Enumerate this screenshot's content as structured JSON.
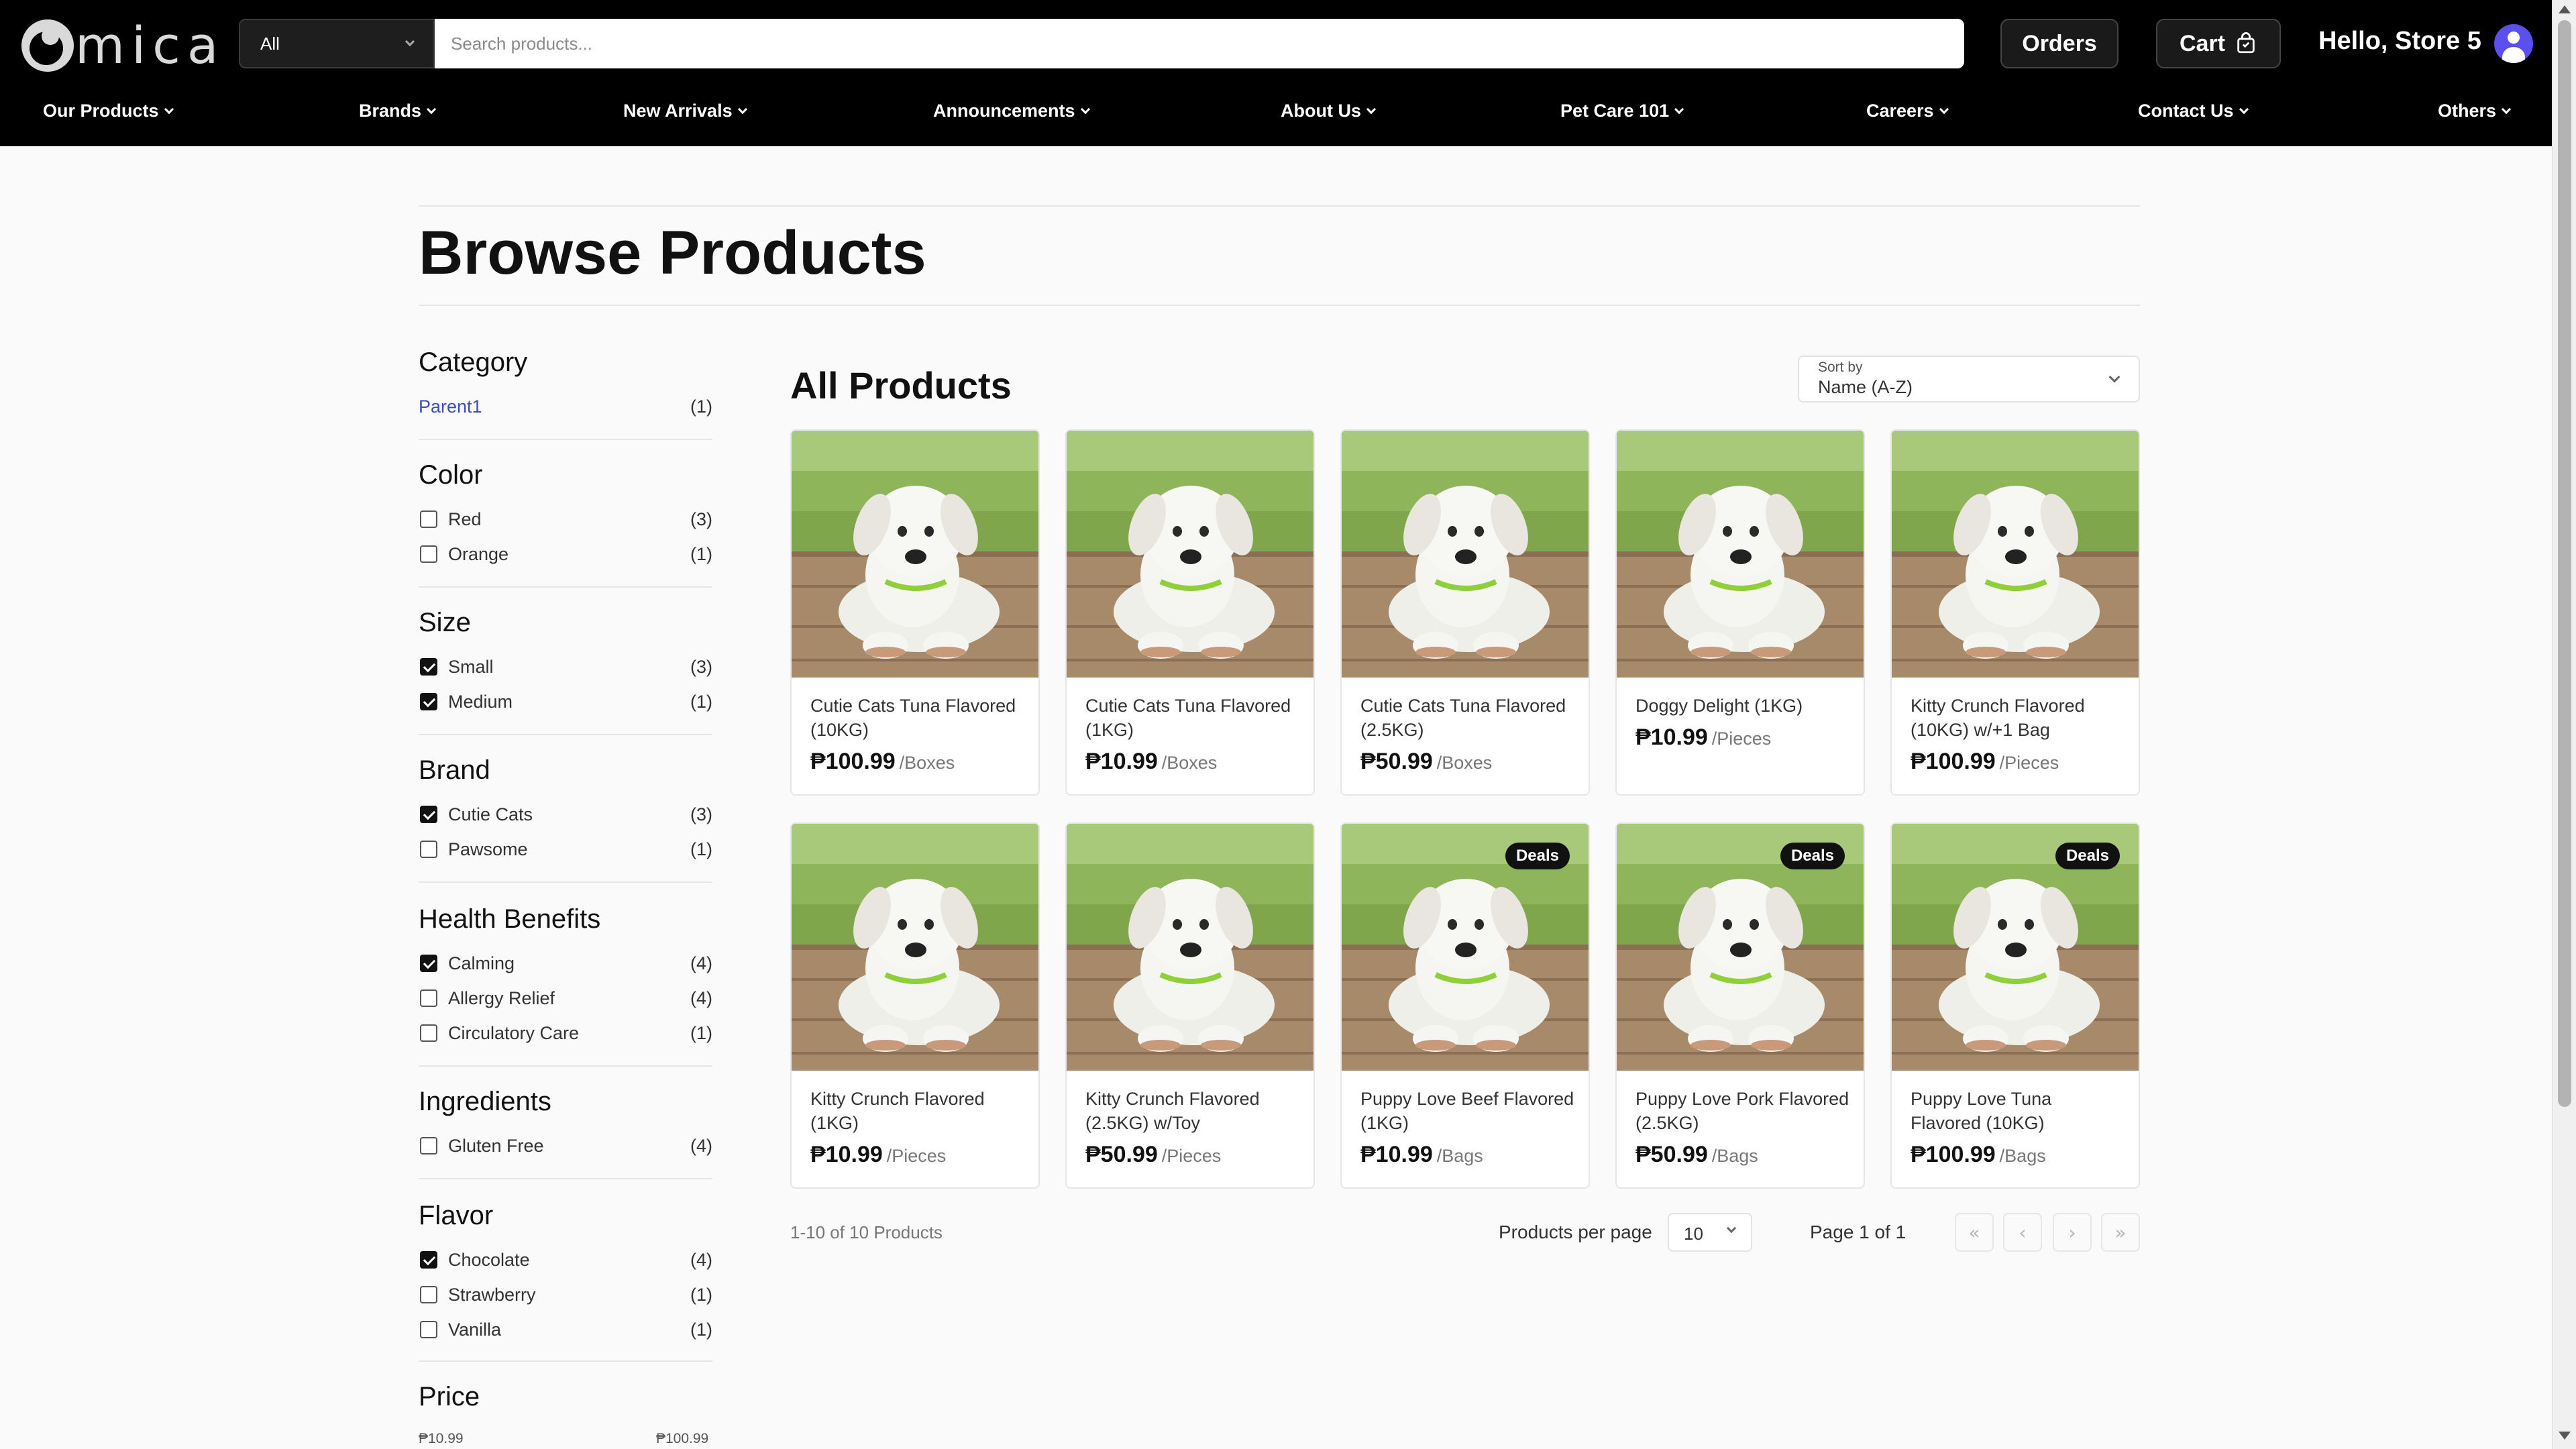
{
  "header": {
    "logo_text": "mica",
    "search_category": "All",
    "search_placeholder": "Search products...",
    "orders_label": "Orders",
    "cart_label": "Cart",
    "greeting": "Hello, Store 5",
    "nav": [
      "Our Products",
      "Brands",
      "New Arrivals",
      "Announcements",
      "About Us",
      "Pet Care 101",
      "Careers",
      "Contact Us",
      "Others"
    ]
  },
  "page_title": "Browse Products",
  "filters": {
    "category": {
      "title": "Category",
      "items": [
        {
          "label": "Parent1",
          "count": "(1)"
        }
      ]
    },
    "color": {
      "title": "Color",
      "items": [
        {
          "label": "Red",
          "count": "(3)",
          "checked": false
        },
        {
          "label": "Orange",
          "count": "(1)",
          "checked": false
        }
      ]
    },
    "size": {
      "title": "Size",
      "items": [
        {
          "label": "Small",
          "count": "(3)",
          "checked": true
        },
        {
          "label": "Medium",
          "count": "(1)",
          "checked": true
        }
      ]
    },
    "brand": {
      "title": "Brand",
      "items": [
        {
          "label": "Cutie Cats",
          "count": "(3)",
          "checked": true
        },
        {
          "label": "Pawsome",
          "count": "(1)",
          "checked": false
        }
      ]
    },
    "health": {
      "title": "Health Benefits",
      "items": [
        {
          "label": "Calming",
          "count": "(4)",
          "checked": true
        },
        {
          "label": "Allergy Relief",
          "count": "(4)",
          "checked": false
        },
        {
          "label": "Circulatory Care",
          "count": "(1)",
          "checked": false
        }
      ]
    },
    "ingredients": {
      "title": "Ingredients",
      "items": [
        {
          "label": "Gluten Free",
          "count": "(4)",
          "checked": false
        }
      ]
    },
    "flavor": {
      "title": "Flavor",
      "items": [
        {
          "label": "Chocolate",
          "count": "(4)",
          "checked": true
        },
        {
          "label": "Strawberry",
          "count": "(1)",
          "checked": false
        },
        {
          "label": "Vanilla",
          "count": "(1)",
          "checked": false
        }
      ]
    },
    "price": {
      "title": "Price",
      "min": "₱10.99",
      "max": "₱100.99"
    }
  },
  "products_section": {
    "title": "All Products",
    "sort_label": "Sort by",
    "sort_value": "Name (A-Z)"
  },
  "products": [
    {
      "name": "Cutie Cats Tuna Flavored (10KG)",
      "price": "₱100.99",
      "unit": "/Boxes",
      "deal": ""
    },
    {
      "name": "Cutie Cats Tuna Flavored (1KG)",
      "price": "₱10.99",
      "unit": "/Boxes",
      "deal": ""
    },
    {
      "name": "Cutie Cats Tuna Flavored (2.5KG)",
      "price": "₱50.99",
      "unit": "/Boxes",
      "deal": ""
    },
    {
      "name": "Doggy Delight (1KG)",
      "price": "₱10.99",
      "unit": "/Pieces",
      "deal": ""
    },
    {
      "name": "Kitty Crunch Flavored (10KG) w/+1 Bag",
      "price": "₱100.99",
      "unit": "/Pieces",
      "deal": ""
    },
    {
      "name": "Kitty Crunch Flavored (1KG)",
      "price": "₱10.99",
      "unit": "/Pieces",
      "deal": ""
    },
    {
      "name": "Kitty Crunch Flavored (2.5KG) w/Toy",
      "price": "₱50.99",
      "unit": "/Pieces",
      "deal": ""
    },
    {
      "name": "Puppy Love Beef Flavored (1KG)",
      "price": "₱10.99",
      "unit": "/Bags",
      "deal": "Deals"
    },
    {
      "name": "Puppy Love Pork Flavored (2.5KG)",
      "price": "₱50.99",
      "unit": "/Bags",
      "deal": "Deals"
    },
    {
      "name": "Puppy Love Tuna Flavored (10KG)",
      "price": "₱100.99",
      "unit": "/Bags",
      "deal": "Deals"
    }
  ],
  "pagination": {
    "range_text": "1-10 of 10 Products",
    "per_page_label": "Products per page",
    "per_page_value": "10",
    "page_info": "Page 1 of 1",
    "first": "«",
    "prev": "‹",
    "next": "›",
    "last": "»"
  },
  "colors": {
    "topbar": "#000000",
    "accent_link": "#3b4fb8",
    "avatar": "#5b4ff0",
    "deal_badge": "#111111"
  },
  "icons": {
    "cart": "shopping-bag-icon",
    "avatar": "user-icon",
    "select": "chevron-down-icon",
    "checkbox": "check-icon"
  }
}
